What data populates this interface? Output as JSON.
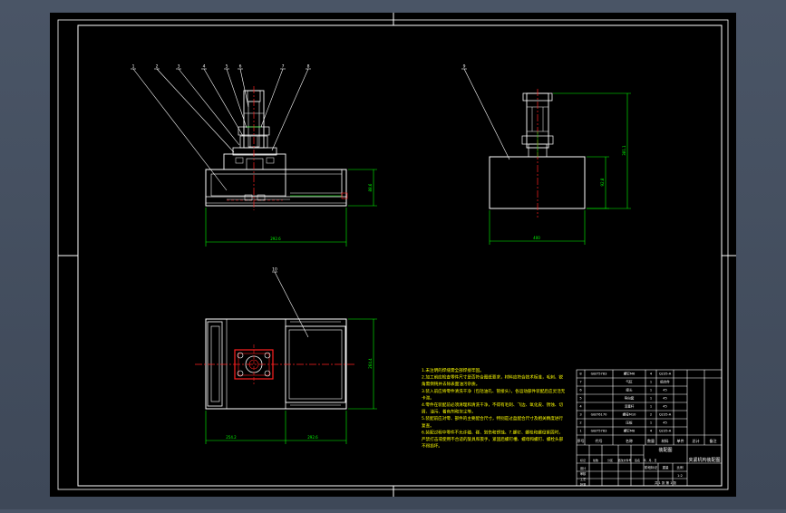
{
  "window": {
    "background": "#465162",
    "sheet_color": "#000000",
    "frame_color": "#ffffff"
  },
  "colors": {
    "outline": "#ffffff",
    "dimension": "#00ff00",
    "centerline": "#ff2020",
    "leader": "#ffffff",
    "callout": "#ffffff",
    "notes": "#ffff00",
    "table_text": "#ffffff"
  },
  "front_view": {
    "callouts": [
      "1",
      "2",
      "3",
      "4",
      "5",
      "6",
      "7",
      "8"
    ],
    "dim_width": "292.6",
    "dim_height": "88.6"
  },
  "side_view": {
    "callouts": [
      "9"
    ],
    "dim_width": "400",
    "dim_height": "92.8",
    "dim_total": "381.1"
  },
  "top_view": {
    "callouts": [
      "10"
    ],
    "dim_left": "254.2",
    "dim_right": "292.6",
    "dim_height": "264.4"
  },
  "tech_notes": [
    "1.未注明的焊缝需全部焊接牢固。",
    "2.加工前应检查零件尺寸是否符合图纸要求，材料应符合技术标准，毛刺、锐角需倒钝并去除表面油污杂质。",
    "3.装入前应将零件清洗干净（包括油孔、管接头），各运动部件装配后应灵活无卡滞。",
    "4.零件在装配前必须清理和清洗干净，不得有毛刺、飞边、氧化皮、锈蚀、切屑、油污、着色剂和灰尘等。",
    "5.装配前应对零、部件的主要配合尺寸，特别是过盈配合尺寸及相关精度进行复查。",
    "6.装配过程中零件不允许磕、碰、划伤和锈蚀。7.螺钉、螺栓和螺母紧固时，严禁打击或使用不合适的旋具和扳手，紧固后螺钉槽、螺母和螺钉、螺栓头部不得损坏。"
  ],
  "bom": {
    "header": [
      "序号",
      "代号",
      "名称",
      "数量",
      "材料",
      "单件",
      "总计",
      "备注"
    ],
    "rows": [
      [
        "8",
        "GB/T5783",
        "螺钉M6",
        "4",
        "Q235-A",
        "",
        "",
        ""
      ],
      [
        "7",
        "",
        "气缸",
        "1",
        "组合件",
        "",
        "",
        ""
      ],
      [
        "6",
        "",
        "接头",
        "1",
        "45",
        "",
        "",
        ""
      ],
      [
        "5",
        "",
        "导向套",
        "1",
        "45",
        "",
        "",
        ""
      ],
      [
        "4",
        "",
        "活塞杆",
        "1",
        "45",
        "",
        "",
        ""
      ],
      [
        "3",
        "GB/T6170",
        "螺母M10",
        "2",
        "Q235-A",
        "",
        "",
        ""
      ],
      [
        "2",
        "",
        "压板",
        "1",
        "45",
        "",
        "",
        ""
      ],
      [
        "1",
        "GB/T5783",
        "螺钉M8",
        "4",
        "Q235-A",
        "",
        "",
        ""
      ]
    ]
  },
  "title_block": {
    "title": "夹紧机构装配图",
    "assembly": "装配图",
    "labels": [
      "标记",
      "处数",
      "分区",
      "更改文件号",
      "签名",
      "年、月、日"
    ],
    "roles": [
      "设计",
      "审核",
      "工艺",
      "批准"
    ],
    "stage_label": "阶段标记",
    "weight_label": "重量",
    "scale_label": "比例",
    "scale_value": "1:2",
    "sheet_text": "共 1 张 第 1 张"
  }
}
